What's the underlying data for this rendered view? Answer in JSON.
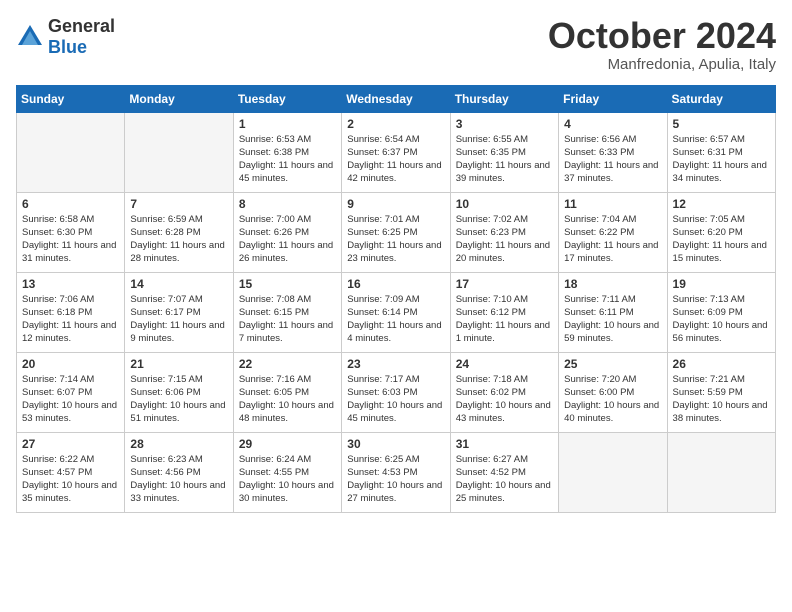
{
  "logo": {
    "general": "General",
    "blue": "Blue"
  },
  "header": {
    "month": "October 2024",
    "location": "Manfredonia, Apulia, Italy"
  },
  "weekdays": [
    "Sunday",
    "Monday",
    "Tuesday",
    "Wednesday",
    "Thursday",
    "Friday",
    "Saturday"
  ],
  "weeks": [
    [
      {
        "day": "",
        "empty": true
      },
      {
        "day": "",
        "empty": true
      },
      {
        "day": "1",
        "sunrise": "Sunrise: 6:53 AM",
        "sunset": "Sunset: 6:38 PM",
        "daylight": "Daylight: 11 hours and 45 minutes."
      },
      {
        "day": "2",
        "sunrise": "Sunrise: 6:54 AM",
        "sunset": "Sunset: 6:37 PM",
        "daylight": "Daylight: 11 hours and 42 minutes."
      },
      {
        "day": "3",
        "sunrise": "Sunrise: 6:55 AM",
        "sunset": "Sunset: 6:35 PM",
        "daylight": "Daylight: 11 hours and 39 minutes."
      },
      {
        "day": "4",
        "sunrise": "Sunrise: 6:56 AM",
        "sunset": "Sunset: 6:33 PM",
        "daylight": "Daylight: 11 hours and 37 minutes."
      },
      {
        "day": "5",
        "sunrise": "Sunrise: 6:57 AM",
        "sunset": "Sunset: 6:31 PM",
        "daylight": "Daylight: 11 hours and 34 minutes."
      }
    ],
    [
      {
        "day": "6",
        "sunrise": "Sunrise: 6:58 AM",
        "sunset": "Sunset: 6:30 PM",
        "daylight": "Daylight: 11 hours and 31 minutes."
      },
      {
        "day": "7",
        "sunrise": "Sunrise: 6:59 AM",
        "sunset": "Sunset: 6:28 PM",
        "daylight": "Daylight: 11 hours and 28 minutes."
      },
      {
        "day": "8",
        "sunrise": "Sunrise: 7:00 AM",
        "sunset": "Sunset: 6:26 PM",
        "daylight": "Daylight: 11 hours and 26 minutes."
      },
      {
        "day": "9",
        "sunrise": "Sunrise: 7:01 AM",
        "sunset": "Sunset: 6:25 PM",
        "daylight": "Daylight: 11 hours and 23 minutes."
      },
      {
        "day": "10",
        "sunrise": "Sunrise: 7:02 AM",
        "sunset": "Sunset: 6:23 PM",
        "daylight": "Daylight: 11 hours and 20 minutes."
      },
      {
        "day": "11",
        "sunrise": "Sunrise: 7:04 AM",
        "sunset": "Sunset: 6:22 PM",
        "daylight": "Daylight: 11 hours and 17 minutes."
      },
      {
        "day": "12",
        "sunrise": "Sunrise: 7:05 AM",
        "sunset": "Sunset: 6:20 PM",
        "daylight": "Daylight: 11 hours and 15 minutes."
      }
    ],
    [
      {
        "day": "13",
        "sunrise": "Sunrise: 7:06 AM",
        "sunset": "Sunset: 6:18 PM",
        "daylight": "Daylight: 11 hours and 12 minutes."
      },
      {
        "day": "14",
        "sunrise": "Sunrise: 7:07 AM",
        "sunset": "Sunset: 6:17 PM",
        "daylight": "Daylight: 11 hours and 9 minutes."
      },
      {
        "day": "15",
        "sunrise": "Sunrise: 7:08 AM",
        "sunset": "Sunset: 6:15 PM",
        "daylight": "Daylight: 11 hours and 7 minutes."
      },
      {
        "day": "16",
        "sunrise": "Sunrise: 7:09 AM",
        "sunset": "Sunset: 6:14 PM",
        "daylight": "Daylight: 11 hours and 4 minutes."
      },
      {
        "day": "17",
        "sunrise": "Sunrise: 7:10 AM",
        "sunset": "Sunset: 6:12 PM",
        "daylight": "Daylight: 11 hours and 1 minute."
      },
      {
        "day": "18",
        "sunrise": "Sunrise: 7:11 AM",
        "sunset": "Sunset: 6:11 PM",
        "daylight": "Daylight: 10 hours and 59 minutes."
      },
      {
        "day": "19",
        "sunrise": "Sunrise: 7:13 AM",
        "sunset": "Sunset: 6:09 PM",
        "daylight": "Daylight: 10 hours and 56 minutes."
      }
    ],
    [
      {
        "day": "20",
        "sunrise": "Sunrise: 7:14 AM",
        "sunset": "Sunset: 6:07 PM",
        "daylight": "Daylight: 10 hours and 53 minutes."
      },
      {
        "day": "21",
        "sunrise": "Sunrise: 7:15 AM",
        "sunset": "Sunset: 6:06 PM",
        "daylight": "Daylight: 10 hours and 51 minutes."
      },
      {
        "day": "22",
        "sunrise": "Sunrise: 7:16 AM",
        "sunset": "Sunset: 6:05 PM",
        "daylight": "Daylight: 10 hours and 48 minutes."
      },
      {
        "day": "23",
        "sunrise": "Sunrise: 7:17 AM",
        "sunset": "Sunset: 6:03 PM",
        "daylight": "Daylight: 10 hours and 45 minutes."
      },
      {
        "day": "24",
        "sunrise": "Sunrise: 7:18 AM",
        "sunset": "Sunset: 6:02 PM",
        "daylight": "Daylight: 10 hours and 43 minutes."
      },
      {
        "day": "25",
        "sunrise": "Sunrise: 7:20 AM",
        "sunset": "Sunset: 6:00 PM",
        "daylight": "Daylight: 10 hours and 40 minutes."
      },
      {
        "day": "26",
        "sunrise": "Sunrise: 7:21 AM",
        "sunset": "Sunset: 5:59 PM",
        "daylight": "Daylight: 10 hours and 38 minutes."
      }
    ],
    [
      {
        "day": "27",
        "sunrise": "Sunrise: 6:22 AM",
        "sunset": "Sunset: 4:57 PM",
        "daylight": "Daylight: 10 hours and 35 minutes."
      },
      {
        "day": "28",
        "sunrise": "Sunrise: 6:23 AM",
        "sunset": "Sunset: 4:56 PM",
        "daylight": "Daylight: 10 hours and 33 minutes."
      },
      {
        "day": "29",
        "sunrise": "Sunrise: 6:24 AM",
        "sunset": "Sunset: 4:55 PM",
        "daylight": "Daylight: 10 hours and 30 minutes."
      },
      {
        "day": "30",
        "sunrise": "Sunrise: 6:25 AM",
        "sunset": "Sunset: 4:53 PM",
        "daylight": "Daylight: 10 hours and 27 minutes."
      },
      {
        "day": "31",
        "sunrise": "Sunrise: 6:27 AM",
        "sunset": "Sunset: 4:52 PM",
        "daylight": "Daylight: 10 hours and 25 minutes."
      },
      {
        "day": "",
        "empty": true
      },
      {
        "day": "",
        "empty": true
      }
    ]
  ]
}
